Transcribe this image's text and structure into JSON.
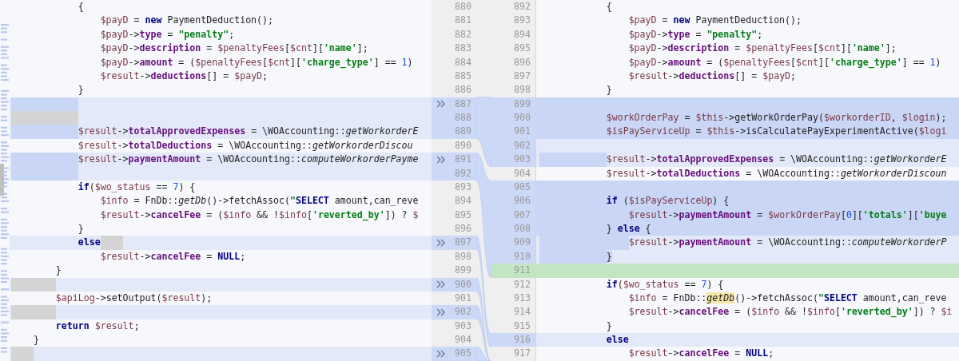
{
  "left_pane": {
    "lines": [
      {
        "number": "880",
        "kind": "plain",
        "tokens": [
          {
            "kind": "indent"
          },
          {
            "kind": "indent"
          },
          {
            "kind": "indent"
          },
          {
            "kind": "plain",
            "text": "{"
          }
        ]
      },
      {
        "number": "881",
        "kind": "plain",
        "tokens": [
          {
            "kind": "indent"
          },
          {
            "kind": "indent"
          },
          {
            "kind": "indent"
          },
          {
            "kind": "indent"
          },
          {
            "kind": "variable",
            "text": "$payD"
          },
          {
            "kind": "plain",
            "text": " = "
          },
          {
            "kind": "keyword",
            "text": "new"
          },
          {
            "kind": "plain",
            "text": " PaymentDeduction();"
          }
        ]
      },
      {
        "number": "882",
        "kind": "plain",
        "tokens": [
          {
            "kind": "indent"
          },
          {
            "kind": "indent"
          },
          {
            "kind": "indent"
          },
          {
            "kind": "indent"
          },
          {
            "kind": "variable",
            "text": "$payD"
          },
          {
            "kind": "plain",
            "text": "->"
          },
          {
            "kind": "field",
            "text": "type"
          },
          {
            "kind": "plain",
            "text": " = "
          },
          {
            "kind": "string",
            "text": "\"penalty\""
          },
          {
            "kind": "plain",
            "text": ";"
          }
        ]
      },
      {
        "number": "883",
        "kind": "plain",
        "tokens": [
          {
            "kind": "indent"
          },
          {
            "kind": "indent"
          },
          {
            "kind": "indent"
          },
          {
            "kind": "indent"
          },
          {
            "kind": "variable",
            "text": "$payD"
          },
          {
            "kind": "plain",
            "text": "->"
          },
          {
            "kind": "field",
            "text": "description"
          },
          {
            "kind": "plain",
            "text": " = "
          },
          {
            "kind": "variable",
            "text": "$penaltyFees"
          },
          {
            "kind": "plain",
            "text": "["
          },
          {
            "kind": "variable",
            "text": "$cnt"
          },
          {
            "kind": "plain",
            "text": "]["
          },
          {
            "kind": "string",
            "text": "'name'"
          },
          {
            "kind": "plain",
            "text": "];"
          }
        ]
      },
      {
        "number": "884",
        "kind": "plain",
        "tokens": [
          {
            "kind": "indent"
          },
          {
            "kind": "indent"
          },
          {
            "kind": "indent"
          },
          {
            "kind": "indent"
          },
          {
            "kind": "variable",
            "text": "$payD"
          },
          {
            "kind": "plain",
            "text": "->"
          },
          {
            "kind": "field",
            "text": "amount"
          },
          {
            "kind": "plain",
            "text": " = ("
          },
          {
            "kind": "variable",
            "text": "$penaltyFees"
          },
          {
            "kind": "plain",
            "text": "["
          },
          {
            "kind": "variable",
            "text": "$cnt"
          },
          {
            "kind": "plain",
            "text": "]["
          },
          {
            "kind": "string",
            "text": "'charge_type'"
          },
          {
            "kind": "plain",
            "text": "] == "
          },
          {
            "kind": "number",
            "text": "1"
          },
          {
            "kind": "plain",
            "text": ")"
          }
        ]
      },
      {
        "number": "885",
        "kind": "plain",
        "tokens": [
          {
            "kind": "indent"
          },
          {
            "kind": "indent"
          },
          {
            "kind": "indent"
          },
          {
            "kind": "indent"
          },
          {
            "kind": "variable",
            "text": "$result"
          },
          {
            "kind": "plain",
            "text": "->"
          },
          {
            "kind": "field",
            "text": "deductions"
          },
          {
            "kind": "plain",
            "text": "[] = "
          },
          {
            "kind": "variable",
            "text": "$payD"
          },
          {
            "kind": "plain",
            "text": ";"
          }
        ]
      },
      {
        "number": "886",
        "kind": "plain",
        "tokens": [
          {
            "kind": "indent"
          },
          {
            "kind": "indent"
          },
          {
            "kind": "indent"
          },
          {
            "kind": "plain",
            "text": "}"
          }
        ]
      },
      {
        "number": "887",
        "kind": "changed",
        "tokens": [
          {
            "kind": "indent-changed"
          },
          {
            "kind": "indent-changed"
          },
          {
            "kind": "indent-changed"
          }
        ]
      },
      {
        "number": "888",
        "kind": "changed",
        "tokens": [
          {
            "kind": "indent-ignored"
          },
          {
            "kind": "indent-ignored"
          },
          {
            "kind": "indent-ignored"
          }
        ]
      },
      {
        "number": "889",
        "kind": "changed",
        "tokens": [
          {
            "kind": "indent-changed"
          },
          {
            "kind": "indent-changed"
          },
          {
            "kind": "indent-changed"
          },
          {
            "kind": "variable",
            "text": "$result"
          },
          {
            "kind": "plain",
            "text": "->"
          },
          {
            "kind": "field",
            "text": "totalApprovedExpenses"
          },
          {
            "kind": "plain",
            "text": " = \\WOAccounting::"
          },
          {
            "kind": "italic",
            "text": "getWorkorderE"
          }
        ]
      },
      {
        "number": "890",
        "kind": "plain",
        "tokens": [
          {
            "kind": "indent"
          },
          {
            "kind": "indent"
          },
          {
            "kind": "indent"
          },
          {
            "kind": "variable",
            "text": "$result"
          },
          {
            "kind": "plain",
            "text": "->"
          },
          {
            "kind": "field",
            "text": "totalDeductions"
          },
          {
            "kind": "plain",
            "text": " = \\WOAccounting::"
          },
          {
            "kind": "italic",
            "text": "getWorkorderDiscou"
          }
        ]
      },
      {
        "number": "891",
        "kind": "changed",
        "tokens": [
          {
            "kind": "indent-changed"
          },
          {
            "kind": "indent-changed"
          },
          {
            "kind": "indent-changed"
          },
          {
            "kind": "variable",
            "text": "$result"
          },
          {
            "kind": "plain",
            "text": "->"
          },
          {
            "kind": "field",
            "text": "paymentAmount"
          },
          {
            "kind": "plain",
            "text": " = \\WOAccounting::"
          },
          {
            "kind": "italic",
            "text": "computeWorkorderPayme"
          }
        ]
      },
      {
        "number": "892",
        "kind": "changed",
        "tokens": [
          {
            "kind": "indent-changed"
          },
          {
            "kind": "indent-changed"
          },
          {
            "kind": "indent-changed"
          }
        ]
      },
      {
        "number": "893",
        "kind": "plain",
        "tokens": [
          {
            "kind": "indent"
          },
          {
            "kind": "indent"
          },
          {
            "kind": "indent"
          },
          {
            "kind": "keyword",
            "text": "if"
          },
          {
            "kind": "plain",
            "text": "("
          },
          {
            "kind": "variable",
            "text": "$wo_status"
          },
          {
            "kind": "plain",
            "text": " == "
          },
          {
            "kind": "number",
            "text": "7"
          },
          {
            "kind": "plain",
            "text": ") {"
          }
        ]
      },
      {
        "number": "894",
        "kind": "plain",
        "tokens": [
          {
            "kind": "indent"
          },
          {
            "kind": "indent"
          },
          {
            "kind": "indent"
          },
          {
            "kind": "indent"
          },
          {
            "kind": "variable",
            "text": "$info"
          },
          {
            "kind": "plain",
            "text": " = FnDb::"
          },
          {
            "kind": "italic",
            "text": "getDb"
          },
          {
            "kind": "plain",
            "text": "()->fetchAssoc("
          },
          {
            "kind": "string",
            "text": "\""
          },
          {
            "kind": "keyword",
            "text": "SELECT"
          },
          {
            "kind": "plain",
            "text": " amount,can_reve"
          }
        ]
      },
      {
        "number": "895",
        "kind": "plain",
        "tokens": [
          {
            "kind": "indent"
          },
          {
            "kind": "indent"
          },
          {
            "kind": "indent"
          },
          {
            "kind": "indent"
          },
          {
            "kind": "variable",
            "text": "$result"
          },
          {
            "kind": "plain",
            "text": "->"
          },
          {
            "kind": "field",
            "text": "cancelFee"
          },
          {
            "kind": "plain",
            "text": " = ("
          },
          {
            "kind": "variable",
            "text": "$info"
          },
          {
            "kind": "plain",
            "text": " && !"
          },
          {
            "kind": "variable",
            "text": "$info"
          },
          {
            "kind": "plain",
            "text": "["
          },
          {
            "kind": "string",
            "text": "'reverted_by'"
          },
          {
            "kind": "plain",
            "text": "]) ? "
          },
          {
            "kind": "variable",
            "text": "$"
          }
        ]
      },
      {
        "number": "896",
        "kind": "plain",
        "tokens": [
          {
            "kind": "indent"
          },
          {
            "kind": "indent"
          },
          {
            "kind": "indent"
          },
          {
            "kind": "plain",
            "text": "}"
          }
        ]
      },
      {
        "number": "897",
        "kind": "changed",
        "tokens": [
          {
            "kind": "indent"
          },
          {
            "kind": "indent"
          },
          {
            "kind": "indent"
          },
          {
            "kind": "keyword",
            "text": "else"
          },
          {
            "kind": "indent-ignored"
          }
        ]
      },
      {
        "number": "898",
        "kind": "plain",
        "tokens": [
          {
            "kind": "indent"
          },
          {
            "kind": "indent"
          },
          {
            "kind": "indent"
          },
          {
            "kind": "indent"
          },
          {
            "kind": "variable",
            "text": "$result"
          },
          {
            "kind": "plain",
            "text": "->"
          },
          {
            "kind": "field",
            "text": "cancelFee"
          },
          {
            "kind": "plain",
            "text": " = "
          },
          {
            "kind": "keyword",
            "text": "NULL"
          },
          {
            "kind": "plain",
            "text": ";"
          }
        ]
      },
      {
        "number": "899",
        "kind": "plain",
        "tokens": [
          {
            "kind": "indent"
          },
          {
            "kind": "indent"
          },
          {
            "kind": "plain",
            "text": "}"
          }
        ]
      },
      {
        "number": "900",
        "kind": "changed",
        "tokens": [
          {
            "kind": "indent-ignored"
          },
          {
            "kind": "indent-ignored"
          }
        ]
      },
      {
        "number": "901",
        "kind": "plain",
        "tokens": [
          {
            "kind": "indent"
          },
          {
            "kind": "indent"
          },
          {
            "kind": "variable",
            "text": "$apiLog"
          },
          {
            "kind": "plain",
            "text": "->setOutput("
          },
          {
            "kind": "variable",
            "text": "$result"
          },
          {
            "kind": "plain",
            "text": ");"
          }
        ]
      },
      {
        "number": "902",
        "kind": "changed",
        "tokens": [
          {
            "kind": "indent-ignored"
          },
          {
            "kind": "indent-ignored"
          }
        ]
      },
      {
        "number": "903",
        "kind": "plain",
        "tokens": [
          {
            "kind": "indent"
          },
          {
            "kind": "indent"
          },
          {
            "kind": "keyword",
            "text": "return"
          },
          {
            "kind": "space"
          },
          {
            "kind": "variable",
            "text": "$result"
          },
          {
            "kind": "plain",
            "text": ";"
          }
        ]
      },
      {
        "number": "904",
        "kind": "plain",
        "tokens": [
          {
            "kind": "indent"
          },
          {
            "kind": "plain",
            "text": "}"
          }
        ]
      },
      {
        "number": "905",
        "kind": "changed",
        "tokens": [
          {
            "kind": "indent-ignored"
          }
        ]
      }
    ]
  },
  "right_pane": {
    "lines": [
      {
        "number": "892",
        "kind": "plain",
        "tokens": [
          {
            "kind": "indent"
          },
          {
            "kind": "indent"
          },
          {
            "kind": "indent"
          },
          {
            "kind": "plain",
            "text": "{"
          }
        ]
      },
      {
        "number": "893",
        "kind": "plain",
        "tokens": [
          {
            "kind": "indent"
          },
          {
            "kind": "indent"
          },
          {
            "kind": "indent"
          },
          {
            "kind": "indent"
          },
          {
            "kind": "variable",
            "text": "$payD"
          },
          {
            "kind": "plain",
            "text": " = "
          },
          {
            "kind": "keyword",
            "text": "new"
          },
          {
            "kind": "plain",
            "text": " PaymentDeduction();"
          }
        ]
      },
      {
        "number": "894",
        "kind": "plain",
        "tokens": [
          {
            "kind": "indent"
          },
          {
            "kind": "indent"
          },
          {
            "kind": "indent"
          },
          {
            "kind": "indent"
          },
          {
            "kind": "variable",
            "text": "$payD"
          },
          {
            "kind": "plain",
            "text": "->"
          },
          {
            "kind": "field",
            "text": "type"
          },
          {
            "kind": "plain",
            "text": " = "
          },
          {
            "kind": "string",
            "text": "\"penalty\""
          },
          {
            "kind": "plain",
            "text": ";"
          }
        ]
      },
      {
        "number": "895",
        "kind": "plain",
        "tokens": [
          {
            "kind": "indent"
          },
          {
            "kind": "indent"
          },
          {
            "kind": "indent"
          },
          {
            "kind": "indent"
          },
          {
            "kind": "variable",
            "text": "$payD"
          },
          {
            "kind": "plain",
            "text": "->"
          },
          {
            "kind": "field",
            "text": "description"
          },
          {
            "kind": "plain",
            "text": " = "
          },
          {
            "kind": "variable",
            "text": "$penaltyFees"
          },
          {
            "kind": "plain",
            "text": "["
          },
          {
            "kind": "variable",
            "text": "$cnt"
          },
          {
            "kind": "plain",
            "text": "]["
          },
          {
            "kind": "string",
            "text": "'name'"
          },
          {
            "kind": "plain",
            "text": "];"
          }
        ]
      },
      {
        "number": "896",
        "kind": "plain",
        "tokens": [
          {
            "kind": "indent"
          },
          {
            "kind": "indent"
          },
          {
            "kind": "indent"
          },
          {
            "kind": "indent"
          },
          {
            "kind": "variable",
            "text": "$payD"
          },
          {
            "kind": "plain",
            "text": "->"
          },
          {
            "kind": "field",
            "text": "amount"
          },
          {
            "kind": "plain",
            "text": " = ("
          },
          {
            "kind": "variable",
            "text": "$penaltyFees"
          },
          {
            "kind": "plain",
            "text": "["
          },
          {
            "kind": "variable",
            "text": "$cnt"
          },
          {
            "kind": "plain",
            "text": "]["
          },
          {
            "kind": "string",
            "text": "'charge_type'"
          },
          {
            "kind": "plain",
            "text": "] == "
          },
          {
            "kind": "number",
            "text": "1"
          },
          {
            "kind": "plain",
            "text": ")"
          }
        ]
      },
      {
        "number": "897",
        "kind": "plain",
        "tokens": [
          {
            "kind": "indent"
          },
          {
            "kind": "indent"
          },
          {
            "kind": "indent"
          },
          {
            "kind": "indent"
          },
          {
            "kind": "variable",
            "text": "$result"
          },
          {
            "kind": "plain",
            "text": "->"
          },
          {
            "kind": "field",
            "text": "deductions"
          },
          {
            "kind": "plain",
            "text": "[] = "
          },
          {
            "kind": "variable",
            "text": "$payD"
          },
          {
            "kind": "plain",
            "text": ";"
          }
        ]
      },
      {
        "number": "898",
        "kind": "plain",
        "tokens": [
          {
            "kind": "indent"
          },
          {
            "kind": "indent"
          },
          {
            "kind": "indent"
          },
          {
            "kind": "plain",
            "text": "}"
          }
        ]
      },
      {
        "number": "899",
        "kind": "strong"
      },
      {
        "number": "900",
        "kind": "strong",
        "tokens": [
          {
            "kind": "indent"
          },
          {
            "kind": "indent"
          },
          {
            "kind": "indent"
          },
          {
            "kind": "variable",
            "text": "$workOrderPay"
          },
          {
            "kind": "plain",
            "text": " = "
          },
          {
            "kind": "variable",
            "text": "$this"
          },
          {
            "kind": "plain",
            "text": "->getWorkOrderPay("
          },
          {
            "kind": "variable",
            "text": "$workorderID"
          },
          {
            "kind": "plain",
            "text": ", "
          },
          {
            "kind": "variable",
            "text": "$login"
          },
          {
            "kind": "plain",
            "text": ");"
          }
        ]
      },
      {
        "number": "901",
        "kind": "strong",
        "tokens": [
          {
            "kind": "indent"
          },
          {
            "kind": "indent"
          },
          {
            "kind": "indent"
          },
          {
            "kind": "variable",
            "text": "$isPayServiceUp"
          },
          {
            "kind": "plain",
            "text": " = "
          },
          {
            "kind": "variable",
            "text": "$this"
          },
          {
            "kind": "plain",
            "text": "->isCalculatePayExperimentActive("
          },
          {
            "kind": "variable",
            "text": "$logi"
          }
        ]
      },
      {
        "number": "902",
        "kind": "changed"
      },
      {
        "number": "903",
        "kind": "changed",
        "tokens": [
          {
            "kind": "indent-changed"
          },
          {
            "kind": "indent-changed"
          },
          {
            "kind": "indent-changed"
          },
          {
            "kind": "variable",
            "text": "$result"
          },
          {
            "kind": "plain",
            "text": "->"
          },
          {
            "kind": "field",
            "text": "totalApprovedExpenses"
          },
          {
            "kind": "plain",
            "text": " = \\WOAccounting::"
          },
          {
            "kind": "italic",
            "text": "getWorkorderE"
          }
        ]
      },
      {
        "number": "904",
        "kind": "plain",
        "tokens": [
          {
            "kind": "indent"
          },
          {
            "kind": "indent"
          },
          {
            "kind": "indent"
          },
          {
            "kind": "variable",
            "text": "$result"
          },
          {
            "kind": "plain",
            "text": "->"
          },
          {
            "kind": "field",
            "text": "totalDeductions"
          },
          {
            "kind": "plain",
            "text": " = \\WOAccounting::"
          },
          {
            "kind": "italic",
            "text": "getWorkorderDiscoun"
          }
        ]
      },
      {
        "number": "905",
        "kind": "strong"
      },
      {
        "number": "906",
        "kind": "strong",
        "tokens": [
          {
            "kind": "indent"
          },
          {
            "kind": "indent"
          },
          {
            "kind": "indent"
          },
          {
            "kind": "keyword",
            "text": "if"
          },
          {
            "kind": "plain",
            "text": " ("
          },
          {
            "kind": "variable",
            "text": "$isPayServiceUp"
          },
          {
            "kind": "plain",
            "text": ") {"
          }
        ]
      },
      {
        "number": "907",
        "kind": "strong",
        "tokens": [
          {
            "kind": "indent"
          },
          {
            "kind": "indent"
          },
          {
            "kind": "indent"
          },
          {
            "kind": "indent"
          },
          {
            "kind": "variable",
            "text": "$result"
          },
          {
            "kind": "plain",
            "text": "->"
          },
          {
            "kind": "field",
            "text": "paymentAmount"
          },
          {
            "kind": "plain",
            "text": " = "
          },
          {
            "kind": "variable",
            "text": "$workOrderPay"
          },
          {
            "kind": "plain",
            "text": "["
          },
          {
            "kind": "number",
            "text": "0"
          },
          {
            "kind": "plain",
            "text": "]["
          },
          {
            "kind": "string",
            "text": "'totals'"
          },
          {
            "kind": "plain",
            "text": "]["
          },
          {
            "kind": "string",
            "text": "'buye"
          }
        ]
      },
      {
        "number": "908",
        "kind": "strong",
        "tokens": [
          {
            "kind": "indent"
          },
          {
            "kind": "indent"
          },
          {
            "kind": "indent"
          },
          {
            "kind": "plain",
            "text": "} "
          },
          {
            "kind": "keyword",
            "text": "else"
          },
          {
            "kind": "plain",
            "text": " {"
          }
        ]
      },
      {
        "number": "909",
        "kind": "changed",
        "tokens": [
          {
            "kind": "indent-changed"
          },
          {
            "kind": "indent-changed"
          },
          {
            "kind": "indent-changed"
          },
          {
            "kind": "indent-changed"
          },
          {
            "kind": "variable",
            "text": "$result"
          },
          {
            "kind": "plain",
            "text": "->"
          },
          {
            "kind": "field",
            "text": "paymentAmount"
          },
          {
            "kind": "plain",
            "text": " = \\WOAccounting::"
          },
          {
            "kind": "italic",
            "text": "computeWorkorderP"
          }
        ]
      },
      {
        "number": "910",
        "kind": "changed",
        "tokens": [
          {
            "kind": "indent-changed"
          },
          {
            "kind": "indent-changed"
          },
          {
            "kind": "indent-changed"
          },
          {
            "kind": "highlight",
            "text": "}"
          }
        ]
      },
      {
        "number": "911",
        "kind": "inserted"
      },
      {
        "number": "912",
        "kind": "plain",
        "tokens": [
          {
            "kind": "indent"
          },
          {
            "kind": "indent"
          },
          {
            "kind": "indent"
          },
          {
            "kind": "keyword",
            "text": "if"
          },
          {
            "kind": "plain",
            "text": "("
          },
          {
            "kind": "variable",
            "text": "$wo_status"
          },
          {
            "kind": "plain",
            "text": " == "
          },
          {
            "kind": "number",
            "text": "7"
          },
          {
            "kind": "plain",
            "text": ") {"
          }
        ]
      },
      {
        "number": "913",
        "kind": "plain",
        "tokens": [
          {
            "kind": "indent"
          },
          {
            "kind": "indent"
          },
          {
            "kind": "indent"
          },
          {
            "kind": "indent"
          },
          {
            "kind": "variable",
            "text": "$info"
          },
          {
            "kind": "plain",
            "text": " = FnDb::"
          },
          {
            "kind": "match",
            "text": "getDb"
          },
          {
            "kind": "plain",
            "text": "()->fetchAssoc("
          },
          {
            "kind": "string",
            "text": "\""
          },
          {
            "kind": "keyword",
            "text": "SELECT"
          },
          {
            "kind": "plain",
            "text": " amount,can_reve"
          }
        ]
      },
      {
        "number": "914",
        "kind": "plain",
        "tokens": [
          {
            "kind": "indent"
          },
          {
            "kind": "indent"
          },
          {
            "kind": "indent"
          },
          {
            "kind": "indent"
          },
          {
            "kind": "variable",
            "text": "$result"
          },
          {
            "kind": "plain",
            "text": "->"
          },
          {
            "kind": "field",
            "text": "cancelFee"
          },
          {
            "kind": "plain",
            "text": " = ("
          },
          {
            "kind": "variable",
            "text": "$info"
          },
          {
            "kind": "plain",
            "text": " && !"
          },
          {
            "kind": "variable",
            "text": "$info"
          },
          {
            "kind": "plain",
            "text": "["
          },
          {
            "kind": "string",
            "text": "'reverted_by'"
          },
          {
            "kind": "plain",
            "text": "]) ? "
          },
          {
            "kind": "variable",
            "text": "$i"
          }
        ]
      },
      {
        "number": "915",
        "kind": "plain",
        "tokens": [
          {
            "kind": "indent"
          },
          {
            "kind": "indent"
          },
          {
            "kind": "indent"
          },
          {
            "kind": "plain",
            "text": "}"
          }
        ]
      },
      {
        "number": "916",
        "kind": "changed",
        "tokens": [
          {
            "kind": "indent"
          },
          {
            "kind": "indent"
          },
          {
            "kind": "indent"
          },
          {
            "kind": "keyword",
            "text": "else"
          }
        ]
      },
      {
        "number": "917",
        "kind": "plain",
        "tokens": [
          {
            "kind": "indent"
          },
          {
            "kind": "indent"
          },
          {
            "kind": "indent"
          },
          {
            "kind": "indent"
          },
          {
            "kind": "variable",
            "text": "$result"
          },
          {
            "kind": "plain",
            "text": "->"
          },
          {
            "kind": "field",
            "text": "cancelFee"
          },
          {
            "kind": "plain",
            "text": " = "
          },
          {
            "kind": "keyword",
            "text": "NULL"
          },
          {
            "kind": "plain",
            "text": ";"
          }
        ]
      }
    ]
  }
}
